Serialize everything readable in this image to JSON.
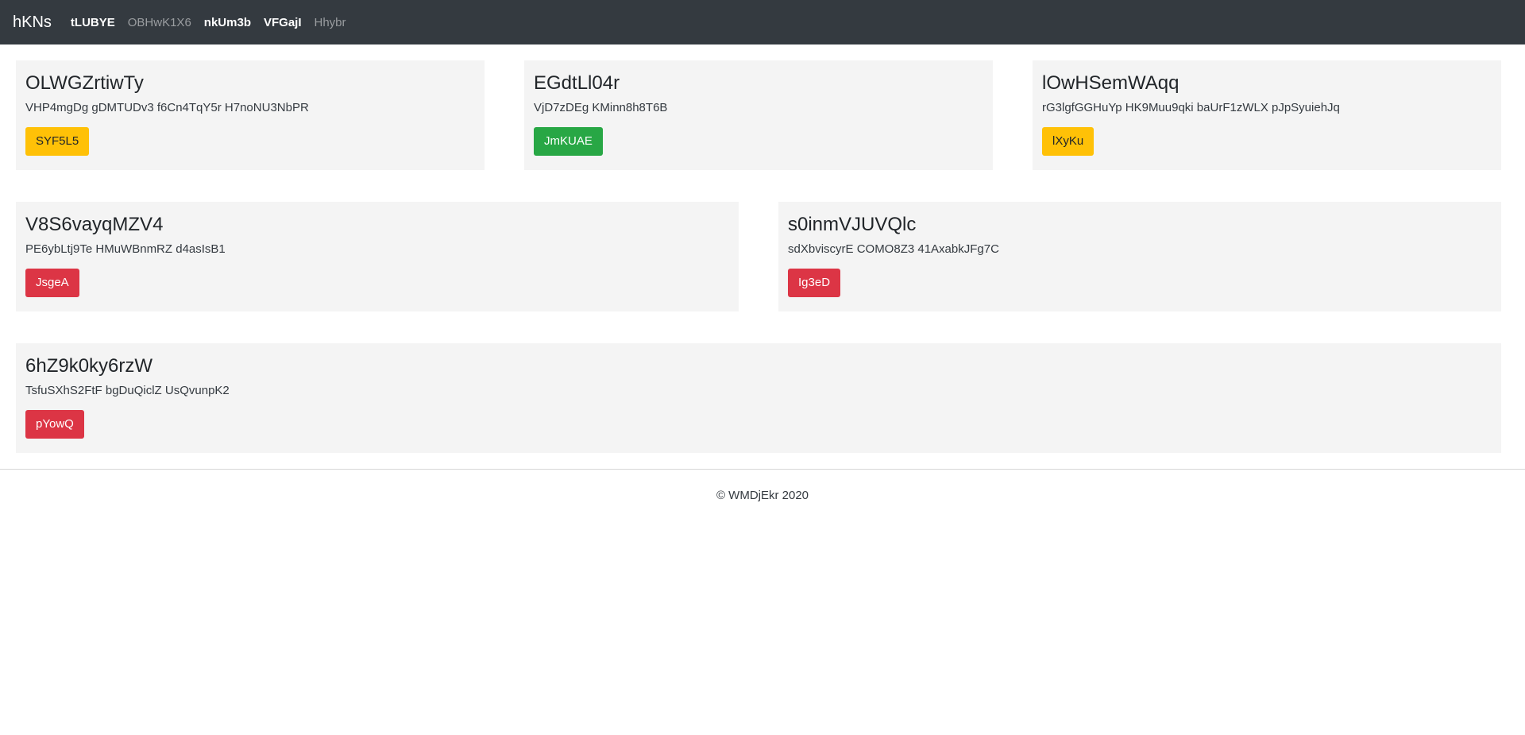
{
  "navbar": {
    "brand": "hKNs",
    "links": [
      {
        "label": "tLUBYE",
        "state": "active"
      },
      {
        "label": "OBHwK1X6",
        "state": "muted"
      },
      {
        "label": "nkUm3b",
        "state": "active"
      },
      {
        "label": "VFGajI",
        "state": "active"
      },
      {
        "label": "Hhybr",
        "state": "muted"
      }
    ]
  },
  "cards": [
    {
      "title": "OLWGZrtiwTy",
      "text": "VHP4mgDg gDMTUDv3 f6Cn4TqY5r H7noNU3NbPR",
      "button": "SYF5L5",
      "button_style": "warning"
    },
    {
      "title": "EGdtLl04r",
      "text": "VjD7zDEg KMinn8h8T6B",
      "button": "JmKUAE",
      "button_style": "success"
    },
    {
      "title": "lOwHSemWAqq",
      "text": "rG3lgfGGHuYp HK9Muu9qki baUrF1zWLX pJpSyuiehJq",
      "button": "lXyKu",
      "button_style": "warning"
    },
    {
      "title": "V8S6vayqMZV4",
      "text": "PE6ybLtj9Te HMuWBnmRZ d4asIsB1",
      "button": "JsgeA",
      "button_style": "danger"
    },
    {
      "title": "s0inmVJUVQlc",
      "text": "sdXbviscyrE COMO8Z3 41AxabkJFg7C",
      "button": "Ig3eD",
      "button_style": "danger"
    },
    {
      "title": "6hZ9k0ky6rzW",
      "text": "TsfuSXhS2FtF bgDuQiclZ UsQvunpK2",
      "button": "pYowQ",
      "button_style": "danger"
    }
  ],
  "footer": {
    "text": "© WMDjEkr 2020"
  },
  "colors": {
    "navbar_bg": "#343a40",
    "card_bg": "#f4f4f4",
    "warning": "#ffc107",
    "success": "#28a745",
    "danger": "#dc3545"
  }
}
